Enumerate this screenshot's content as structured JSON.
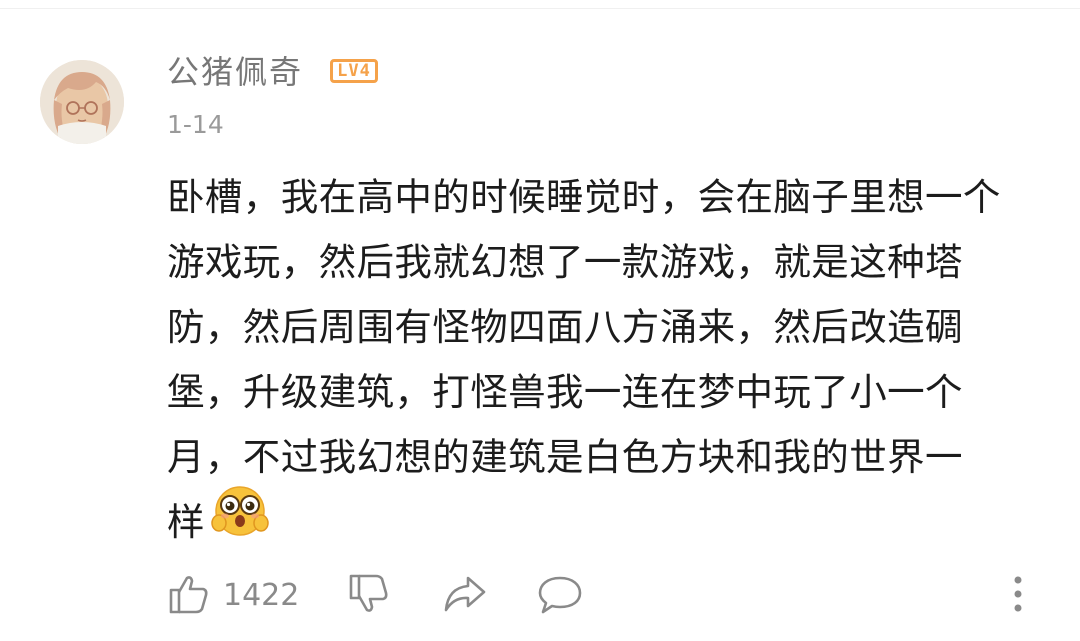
{
  "comment": {
    "username": "公猪佩奇",
    "level": "LV4",
    "date": "1-14",
    "text_lines": [
      "卧槽，我在高中的时候睡觉时，会在脑子里想一个",
      "游戏玩，然后我就幻想了一款游戏，就是这种塔",
      "防，然后周围有怪物四面八方涌来，然后改造碉",
      "堡，升级建筑，打怪兽我一连在梦中玩了小一个",
      "月，不过我幻想的建筑是白色方块和我的世界一",
      "样"
    ],
    "emoji": "shocked-face-emoji",
    "like_count": "1422"
  },
  "icons": {
    "like": "thumbs-up-icon",
    "dislike": "thumbs-down-icon",
    "share": "share-arrow-icon",
    "reply": "comment-bubble-icon",
    "more": "more-vertical-icon"
  },
  "colors": {
    "username": "#777777",
    "badge": "#f5a24a",
    "text": "#1c1c1c",
    "meta": "#9a9a9a"
  }
}
